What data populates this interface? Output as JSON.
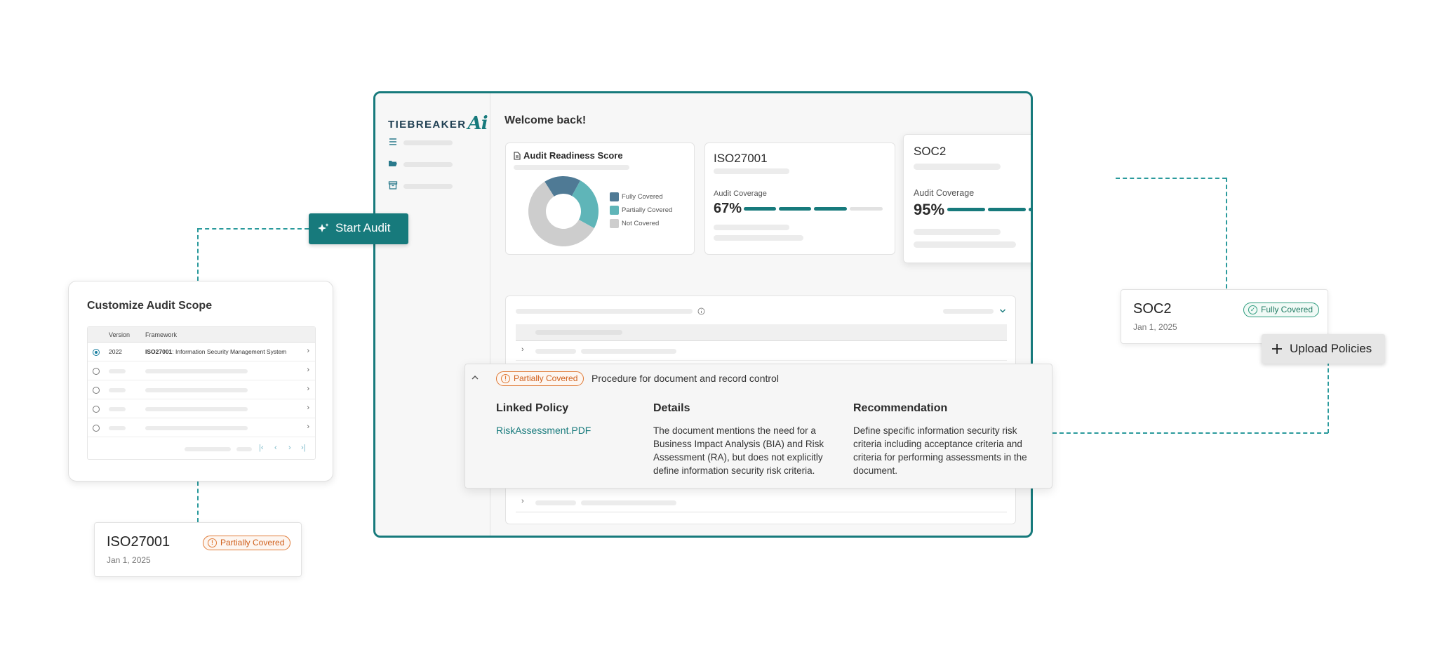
{
  "start_audit": {
    "label": "Start Audit",
    "icon": "sparkles-icon"
  },
  "upload_policies": {
    "label": "Upload Policies",
    "icon": "plus-icon"
  },
  "app": {
    "logo_text": "TIEBREAKER",
    "logo_mark": "Ai",
    "welcome": "Welcome back!",
    "nav_icons": [
      "menu-icon",
      "folder-open-icon",
      "archive-icon"
    ],
    "readiness": {
      "title": "Audit Readiness Score",
      "legend": [
        "Fully Covered",
        "Partially Covered",
        "Not Covered"
      ],
      "colors": {
        "fully": "#4f7a95",
        "partially": "#5fb5b8",
        "not": "#cdcdcd"
      }
    },
    "iso_card": {
      "title": "ISO27001",
      "coverage_label": "Audit Coverage",
      "percent": "67%",
      "coverage_fraction": 0.67
    },
    "soc2_card": {
      "title": "SOC2",
      "coverage_label": "Audit Coverage",
      "percent": "95%",
      "coverage_fraction": 0.95
    }
  },
  "detail": {
    "status": "Partially Covered",
    "procedure": "Procedure for document and record control",
    "linked_policy_heading": "Linked Policy",
    "linked_policy_file": "RiskAssessment.PDF",
    "details_heading": "Details",
    "details_text": "The document mentions the need for a Business Impact Analysis (BIA) and Risk Assessment (RA), but does not explicitly define information security risk criteria.",
    "recommendation_heading": "Recommendation",
    "recommendation_text": "Define specific information security risk criteria including acceptance criteria and criteria for performing assessments in the document."
  },
  "scope": {
    "title": "Customize Audit Scope",
    "columns": [
      "Version",
      "Framework"
    ],
    "selected_row": {
      "version": "2022",
      "framework_bold": "ISO27001",
      "framework_rest": ": Information Security Management System"
    }
  },
  "iso_status": {
    "title": "ISO27001",
    "badge": "Partially Covered",
    "date": "Jan 1, 2025"
  },
  "soc2_status": {
    "title": "SOC2",
    "badge": "Fully Covered",
    "date": "Jan 1, 2025"
  },
  "colors": {
    "brand": "#177a7c",
    "connector": "#2a9a9c",
    "partial": "#e07a36",
    "full": "#2a9a7c"
  }
}
